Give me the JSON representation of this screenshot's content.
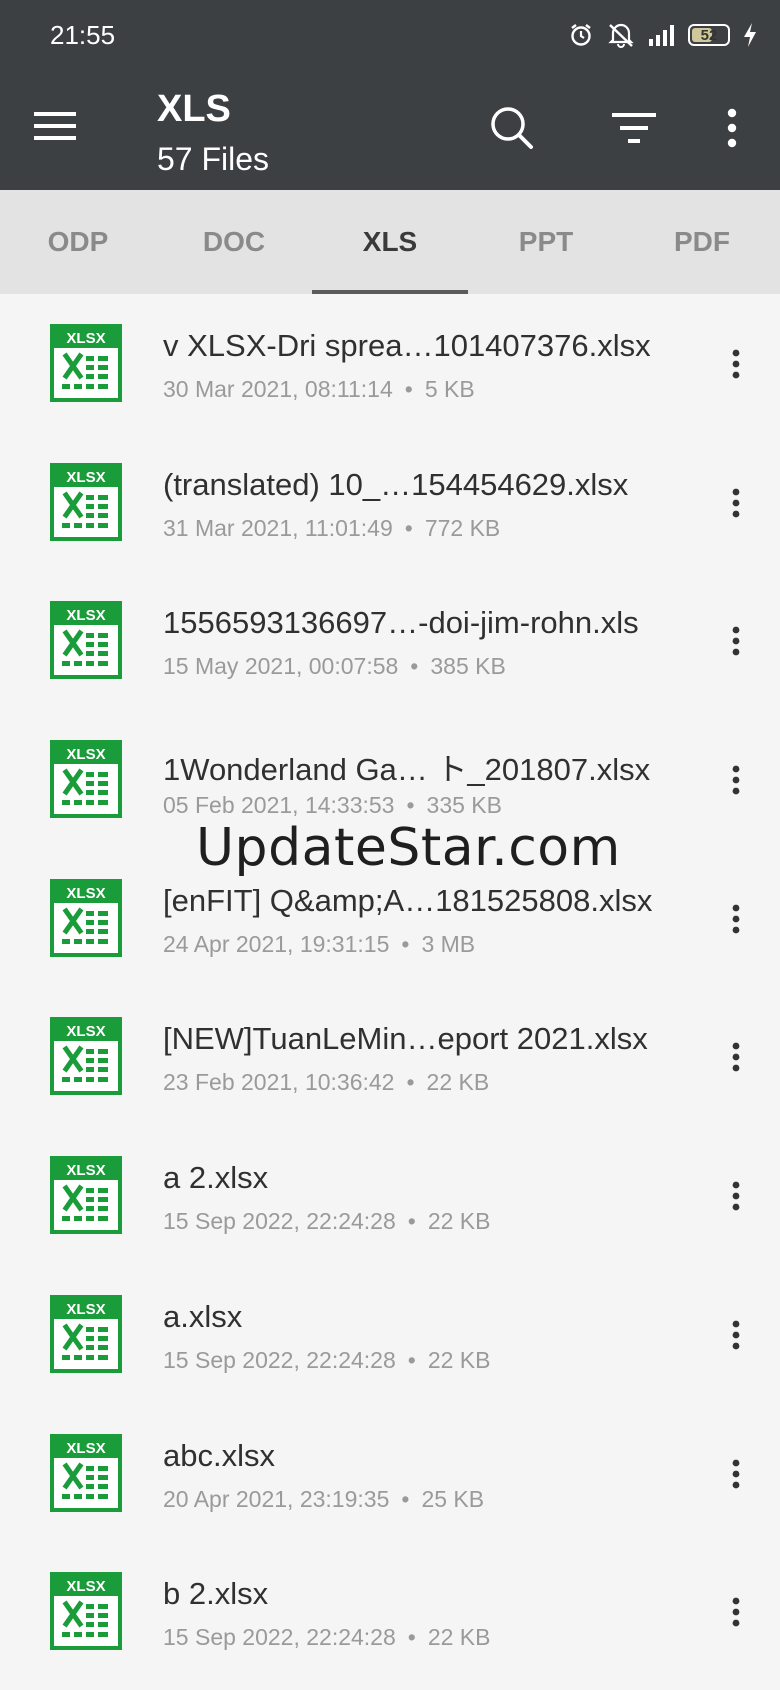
{
  "status_bar": {
    "time": "21:55",
    "battery_level": "52",
    "icons": [
      "alarm-icon",
      "mute-icon",
      "signal-icon",
      "battery-icon",
      "charging-icon"
    ]
  },
  "header": {
    "title": "XLS",
    "subtitle": "57 Files",
    "icons": [
      "menu-icon",
      "search-icon",
      "filter-icon",
      "more-vert-icon"
    ]
  },
  "tabs": [
    {
      "label": "ODP",
      "active": false
    },
    {
      "label": "DOC",
      "active": false
    },
    {
      "label": "XLS",
      "active": true
    },
    {
      "label": "PPT",
      "active": false
    },
    {
      "label": "PDF",
      "active": false
    }
  ],
  "files": [
    {
      "name": "v XLSX-Dri sprea…101407376.xlsx",
      "date": "30 Mar 2021, 08:11:14",
      "size": "5 KB"
    },
    {
      "name": "(translated) 10_…154454629.xlsx",
      "date": "31 Mar 2021, 11:01:49",
      "size": "772 KB"
    },
    {
      "name": "1556593136697…-doi-jim-rohn.xls",
      "date": "15 May 2021, 00:07:58",
      "size": "385 KB"
    },
    {
      "name": "1Wonderland Ga… ト_201807.xlsx",
      "date": "05 Feb 2021, 14:33:53",
      "size": "335 KB"
    },
    {
      "name": "[enFIT] Q&amp;A…181525808.xlsx",
      "date": "24 Apr 2021, 19:31:15",
      "size": "3 MB"
    },
    {
      "name": "[NEW]TuanLeMin…eport 2021.xlsx",
      "date": "23 Feb 2021, 10:36:42",
      "size": "22 KB"
    },
    {
      "name": "a 2.xlsx",
      "date": "15 Sep 2022, 22:24:28",
      "size": "22 KB"
    },
    {
      "name": "a.xlsx",
      "date": "15 Sep 2022, 22:24:28",
      "size": "22 KB"
    },
    {
      "name": "abc.xlsx",
      "date": "20 Apr 2021, 23:19:35",
      "size": "25 KB"
    },
    {
      "name": "b 2.xlsx",
      "date": "15 Sep 2022, 22:24:28",
      "size": "22 KB"
    }
  ],
  "file_icon": {
    "label": "XLSX",
    "color": "#1a9c3a"
  },
  "meta_separator": "•",
  "watermark": "UpdateStar.com",
  "colors": {
    "appbar": "#3d4043",
    "tabbar": "#e3e3e3",
    "list_bg": "#f5f5f5",
    "excel_green": "#1a9c3a"
  }
}
